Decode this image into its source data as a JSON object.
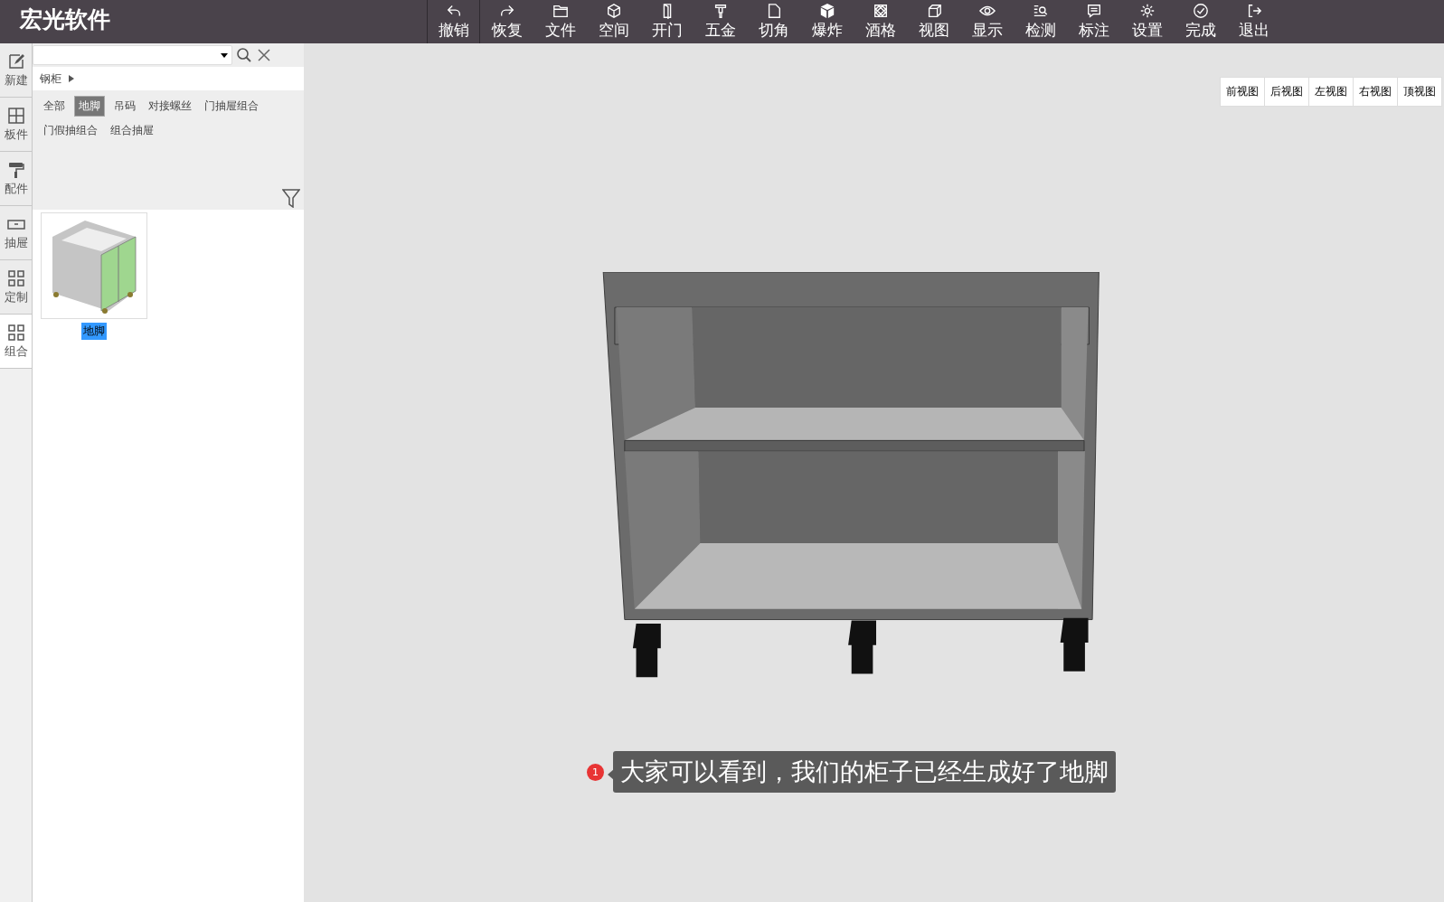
{
  "app": {
    "title": "宏光软件"
  },
  "toolbar": [
    {
      "label": "撤销"
    },
    {
      "label": "恢复"
    },
    {
      "label": "文件"
    },
    {
      "label": "空间"
    },
    {
      "label": "开门"
    },
    {
      "label": "五金"
    },
    {
      "label": "切角"
    },
    {
      "label": "爆炸"
    },
    {
      "label": "酒格"
    },
    {
      "label": "视图"
    },
    {
      "label": "显示"
    },
    {
      "label": "检测"
    },
    {
      "label": "标注"
    },
    {
      "label": "设置"
    },
    {
      "label": "完成"
    },
    {
      "label": "退出"
    }
  ],
  "rail": [
    {
      "label": "新建",
      "selected": false
    },
    {
      "label": "板件",
      "selected": false
    },
    {
      "label": "配件",
      "selected": false
    },
    {
      "label": "抽屉",
      "selected": false
    },
    {
      "label": "定制",
      "selected": false
    },
    {
      "label": "组合",
      "selected": true
    }
  ],
  "breadcrumb": {
    "label": "钢柜"
  },
  "categories": [
    {
      "label": "全部",
      "selected": false
    },
    {
      "label": "地脚",
      "selected": true
    },
    {
      "label": "吊码",
      "selected": false
    },
    {
      "label": "对接螺丝",
      "selected": false
    },
    {
      "label": "门抽屉组合",
      "selected": false
    },
    {
      "label": "门假抽组合",
      "selected": false
    },
    {
      "label": "组合抽屉",
      "selected": false
    }
  ],
  "items": [
    {
      "label": "地脚",
      "selected": true
    }
  ],
  "views": [
    {
      "label": "前视图"
    },
    {
      "label": "后视图"
    },
    {
      "label": "左视图"
    },
    {
      "label": "右视图"
    },
    {
      "label": "顶视图"
    }
  ],
  "caption": {
    "badge": "1",
    "text": "大家可以看到，我们的柜子已经生成好了地脚"
  }
}
